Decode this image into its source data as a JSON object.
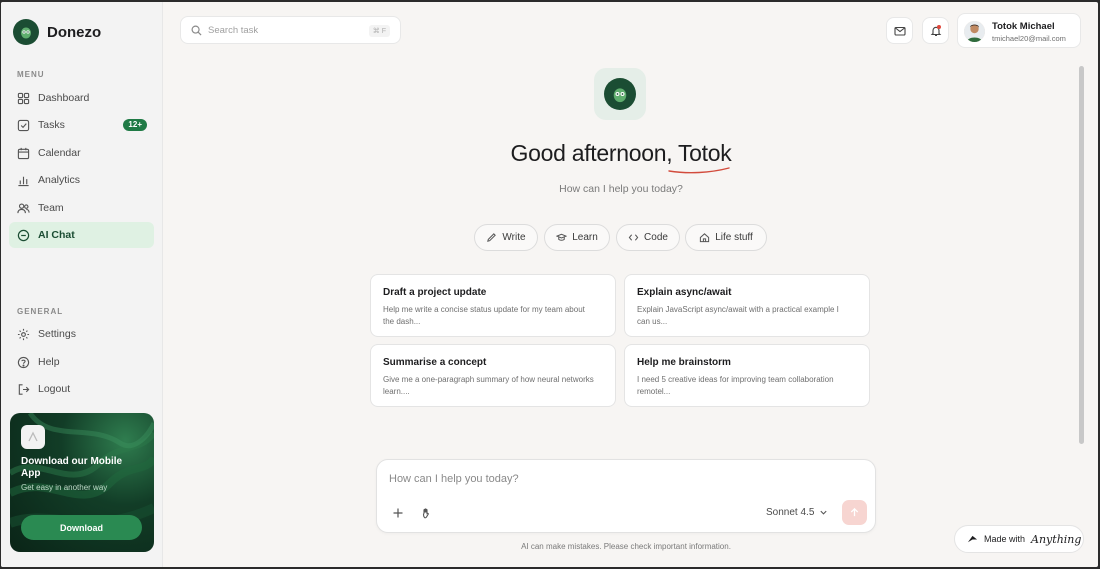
{
  "brand": {
    "name": "Donezo"
  },
  "sidebar": {
    "menu_label": "MENU",
    "items": [
      {
        "label": "Dashboard",
        "icon": "grid-icon"
      },
      {
        "label": "Tasks",
        "icon": "checkbox-icon",
        "badge": "12+"
      },
      {
        "label": "Calendar",
        "icon": "calendar-icon"
      },
      {
        "label": "Analytics",
        "icon": "bar-chart-icon"
      },
      {
        "label": "Team",
        "icon": "users-icon"
      },
      {
        "label": "AI Chat",
        "icon": "chat-circle-icon",
        "active": true
      }
    ],
    "general_label": "GENERAL",
    "general_items": [
      {
        "label": "Settings",
        "icon": "gear-icon"
      },
      {
        "label": "Help",
        "icon": "help-icon"
      },
      {
        "label": "Logout",
        "icon": "logout-icon"
      }
    ],
    "promo": {
      "title": "Download our Mobile App",
      "subtitle": "Get easy in another way",
      "button": "Download"
    }
  },
  "topbar": {
    "search_placeholder": "Search task",
    "search_shortcut": "⌘ F",
    "user": {
      "name": "Totok Michael",
      "email": "tmichael20@mail.com"
    }
  },
  "main": {
    "greeting": "Good afternoon, Totok",
    "subtitle": "How can I help you today?",
    "chips": [
      {
        "label": "Write",
        "icon": "pencil-icon"
      },
      {
        "label": "Learn",
        "icon": "graduation-cap-icon"
      },
      {
        "label": "Code",
        "icon": "code-icon"
      },
      {
        "label": "Life stuff",
        "icon": "home-icon"
      }
    ],
    "cards": [
      {
        "title": "Draft a project update",
        "desc": "Help me write a concise status update for my team about the dash..."
      },
      {
        "title": "Explain async/await",
        "desc": "Explain JavaScript async/await with a practical example I can us..."
      },
      {
        "title": "Summarise a concept",
        "desc": "Give me a one-paragraph summary of how neural networks learn...."
      },
      {
        "title": "Help me brainstorm",
        "desc": "I need 5 creative ideas for improving team collaboration remotel..."
      }
    ],
    "composer": {
      "placeholder": "How can I help you today?",
      "model": "Sonnet 4.5"
    },
    "disclaimer": "AI can make mistakes. Please check important information."
  },
  "made_with": {
    "prefix": "Made with",
    "brand": "Anything"
  },
  "colors": {
    "accent": "#1f7a45",
    "brand_dark": "#1b4d33",
    "active_bg": "#dff1e3",
    "send_bg": "#f7d5d1",
    "underline": "#d24b3c"
  }
}
